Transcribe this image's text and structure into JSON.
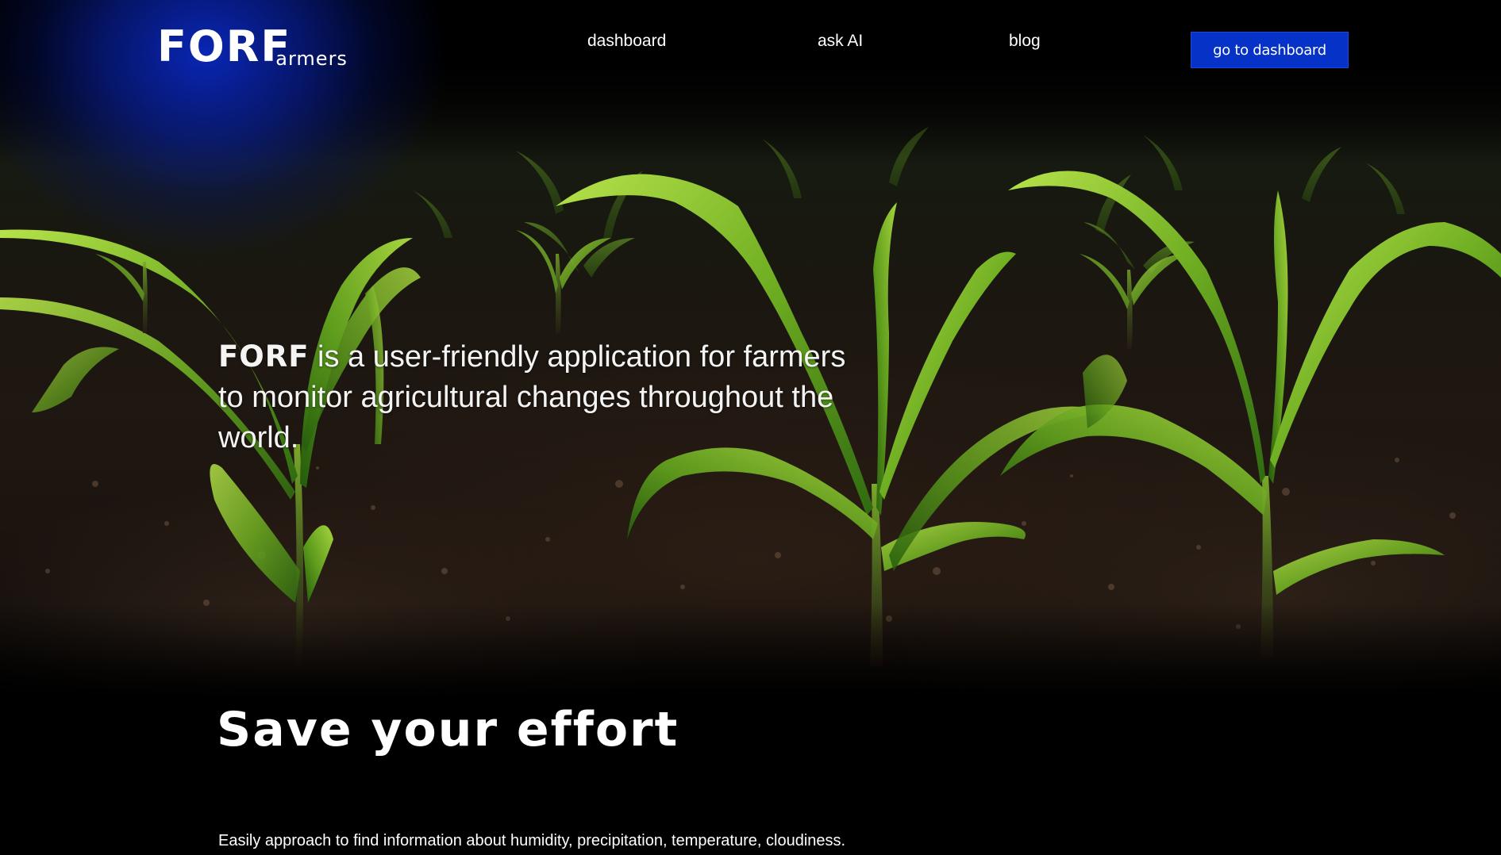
{
  "header": {
    "logo": {
      "main": "FORF",
      "sub": "armers"
    },
    "nav": [
      {
        "label": "dashboard"
      },
      {
        "label": "ask AI"
      },
      {
        "label": "blog"
      }
    ],
    "cta_label": "go to dashboard"
  },
  "hero": {
    "brand": "FORF",
    "text": " is a user-friendly application for farmers to monitor agricultural changes throughout the world."
  },
  "section": {
    "title": "Save your effort",
    "description": "Easily approach to find information about humidity, precipitation, temperature, cloudiness."
  },
  "colors": {
    "accent": "#0632c8",
    "background": "#000000",
    "glow": "#0a28be"
  }
}
